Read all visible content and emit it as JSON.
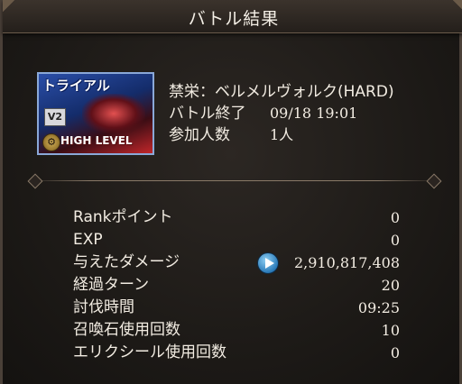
{
  "header": {
    "title": "バトル結果"
  },
  "quest": {
    "banner": {
      "trial": "トライアル",
      "version": "V2",
      "level": "HIGH LEVEL"
    },
    "name": "禁栄：ベルメルヴォルク(HARD)",
    "end_label": "バトル終了",
    "end_value": "09/18 19:01",
    "players_label": "参加人数",
    "players_value": "1人"
  },
  "results": [
    {
      "label": "Rankポイント",
      "value": "0"
    },
    {
      "label": "EXP",
      "value": "0"
    },
    {
      "label": "与えたダメージ",
      "value": "2,910,817,408"
    },
    {
      "label": "経過ターン",
      "value": "20"
    },
    {
      "label": "討伐時間",
      "value": "09:25"
    },
    {
      "label": "召喚石使用回数",
      "value": "10"
    },
    {
      "label": "エリクシール使用回数",
      "value": "0"
    }
  ]
}
